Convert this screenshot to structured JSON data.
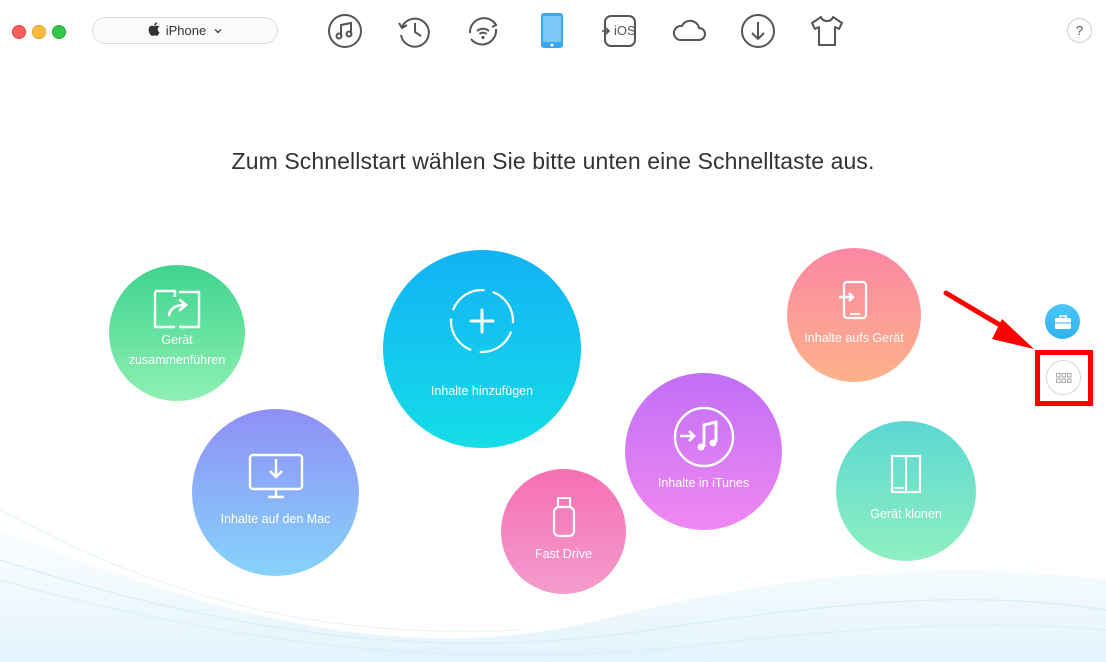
{
  "window": {
    "traffic_lights": [
      "close",
      "minimize",
      "zoom"
    ]
  },
  "device_selector": {
    "value": "iPhone",
    "icon": "apple-icon",
    "chevron": "chevron-down-icon"
  },
  "toolbar": {
    "items": [
      {
        "name": "music-icon",
        "active": false
      },
      {
        "name": "history-icon",
        "active": false
      },
      {
        "name": "wifi-sync-icon",
        "active": false
      },
      {
        "name": "phone-icon",
        "active": true
      },
      {
        "name": "to-ios-icon",
        "label": "iOS",
        "active": false
      },
      {
        "name": "cloud-icon",
        "active": false
      },
      {
        "name": "download-icon",
        "active": false
      },
      {
        "name": "shirt-icon",
        "active": false
      }
    ],
    "help_label": "?"
  },
  "headline": "Zum Schnellstart wählen Sie bitte unten eine Schnelltaste aus.",
  "shortcuts": {
    "merge": {
      "line1": "Gerät",
      "line2": "zusammenführen"
    },
    "add": {
      "label": "Inhalte hinzufügen"
    },
    "mac": {
      "label": "Inhalte auf den Mac"
    },
    "fast_drive": {
      "label": "Fast Drive"
    },
    "itunes": {
      "label": "Inhalte in iTunes"
    },
    "device": {
      "label": "Inhalte aufs Gerät"
    },
    "clone": {
      "label": "Gerät klonen"
    }
  },
  "side_buttons": [
    {
      "name": "toolbox-icon",
      "active": true
    },
    {
      "name": "grid-icon",
      "active": false
    }
  ],
  "colors": {
    "accent": "#12b2f5",
    "highlight": "#ff0000",
    "icon_gray": "#555555"
  }
}
